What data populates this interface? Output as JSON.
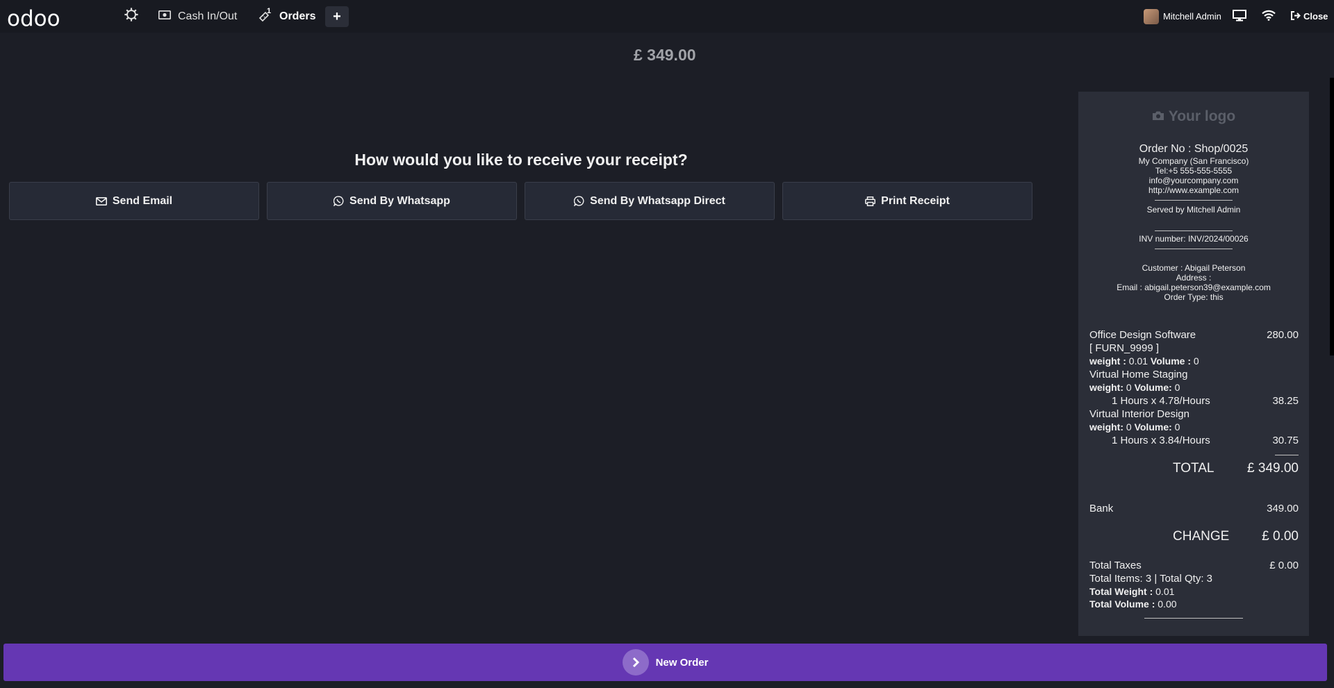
{
  "topbar": {
    "logo": "odoo",
    "cash_label": "Cash In/Out",
    "orders_badge": "1",
    "orders_label": "Orders",
    "plus": "+",
    "user_name": "Mitchell Admin",
    "close_label": "Close"
  },
  "amount": "£ 349.00",
  "question": "How would you like to receive your receipt?",
  "actions": {
    "email": "Send Email",
    "whatsapp": "Send By Whatsapp",
    "whatsapp_direct": "Send By Whatsapp Direct",
    "print": "Print Receipt"
  },
  "receipt": {
    "logo": "Your logo",
    "order_no": "Order No : Shop/0025",
    "company": "My Company (San Francisco)",
    "tel": "Tel:+5 555-555-5555",
    "email": "info@yourcompany.com",
    "website": "http://www.example.com",
    "served_by": "Served by Mitchell Admin",
    "inv_number": "INV number: INV/2024/00026",
    "customer": "Customer : Abigail Peterson",
    "address": "Address :",
    "customer_email": "Email : abigail.peterson39@example.com",
    "order_type": "Order Type: this",
    "lines": {
      "l1_name": "Office Design Software",
      "l1_price": "280.00",
      "l1_ref": "[ FURN_9999 ]",
      "l1_weight_label": "weight :",
      "l1_weight": "0.01",
      "l1_volume_label": "Volume :",
      "l1_volume": "0",
      "l2_name": "Virtual Home Staging",
      "l2_weight_label": "weight:",
      "l2_weight": "0",
      "l2_volume_label": "Volume:",
      "l2_volume": "0",
      "l2_qty": "1 Hours x 4.78/Hours",
      "l2_price": "38.25",
      "l3_name": "Virtual Interior Design",
      "l3_weight_label": "weight:",
      "l3_weight": "0",
      "l3_volume_label": "Volume:",
      "l3_volume": "0",
      "l3_qty": "1 Hours x 3.84/Hours",
      "l3_price": "30.75"
    },
    "total_label": "TOTAL",
    "total_value": "£ 349.00",
    "bank_label": "Bank",
    "bank_value": "349.00",
    "change_label": "CHANGE",
    "change_value": "£ 0.00",
    "taxes_label": "Total Taxes",
    "taxes_value": "£ 0.00",
    "items_qty": "Total Items: 3 | Total Qty: 3",
    "weight_label": "Total Weight :",
    "weight_value": "0.01",
    "volume_label": "Total Volume :",
    "volume_value": "0.00"
  },
  "bottom": {
    "new_order": "New Order"
  }
}
